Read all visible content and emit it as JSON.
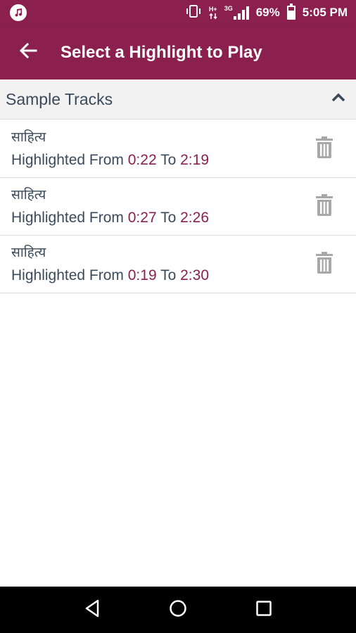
{
  "status_bar": {
    "network_top": "H+",
    "network_sub": "3G",
    "battery_percent": "69%",
    "battery_level": 0.69,
    "time": "5:05 PM",
    "icons": [
      "music-icon",
      "vibrate-icon",
      "signal-icon",
      "battery-icon"
    ]
  },
  "app_bar": {
    "title": "Select a Highlight to Play",
    "back_icon": "arrow-left-icon",
    "background": "#8b1f4e"
  },
  "section": {
    "title": "Sample Tracks",
    "toggle_icon": "chevron-up-icon"
  },
  "tracks": [
    {
      "name": "साहित्य",
      "from_label": "Highlighted From",
      "from": "0:22",
      "to_label": "To",
      "to": "2:19"
    },
    {
      "name": "साहित्य",
      "from_label": "Highlighted From",
      "from": "0:27",
      "to_label": "To",
      "to": "2:26"
    },
    {
      "name": "साहित्य",
      "from_label": "Highlighted From",
      "from": "0:19",
      "to_label": "To",
      "to": "2:30"
    }
  ],
  "colors": {
    "accent": "#8b1f4e",
    "text": "#3a4a5a",
    "delete_icon": "#a8a8a8"
  },
  "nav_bar": {
    "buttons": [
      "back-triangle-icon",
      "home-circle-icon",
      "recents-square-icon"
    ]
  }
}
